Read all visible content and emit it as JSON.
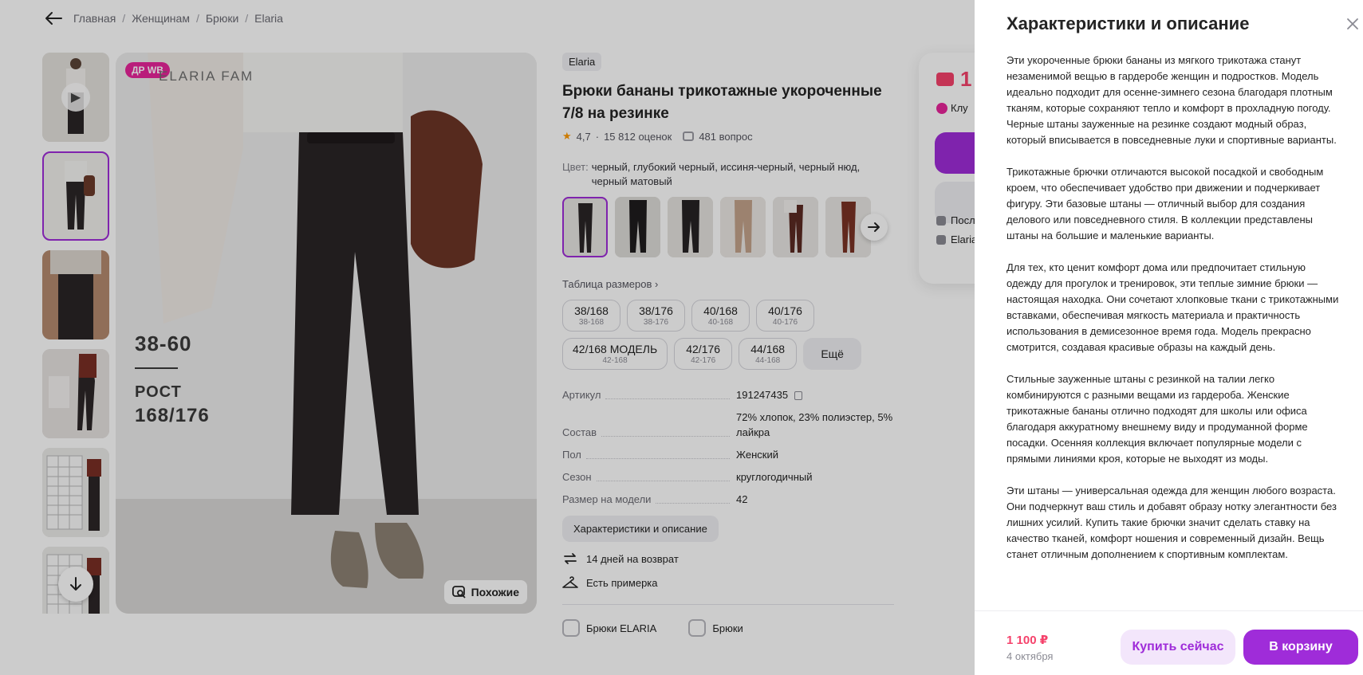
{
  "breadcrumbs": [
    "Главная",
    "Женщинам",
    "Брюки",
    "Elaria"
  ],
  "gallery": {
    "badge": "ДР WB",
    "watermark": "ELARIA FAM",
    "overlay_range": "38-60",
    "overlay_label": "РОСТ",
    "overlay_height": "168/176",
    "similar_label": "Похожие"
  },
  "product": {
    "brand": "Elaria",
    "title": "Брюки бананы трикотажные укороченные 7/8 на резинке",
    "rating": "4,7",
    "reviews": "15 812 оценок",
    "questions": "481 вопрос",
    "color_label": "Цвет:",
    "color_value": "черный, глубокий черный, иссиня-черный, черный нюд, черный матовый",
    "sizes_title": "Таблица размеров",
    "sizes": [
      {
        "main": "38/168",
        "sub": "38-168"
      },
      {
        "main": "38/176",
        "sub": "38-176"
      },
      {
        "main": "40/168",
        "sub": "40-168"
      },
      {
        "main": "40/176",
        "sub": "40-176"
      },
      {
        "main": "42/168 МОДЕЛЬ",
        "sub": "42-168"
      },
      {
        "main": "42/176",
        "sub": "42-176"
      },
      {
        "main": "44/168",
        "sub": "44-168"
      }
    ],
    "sizes_more": "Ещё",
    "specs": [
      {
        "k": "Артикул",
        "v": "191247435"
      },
      {
        "k": "Состав",
        "v": "72% хлопок, 23% полиэстер, 5% лайкра"
      },
      {
        "k": "Пол",
        "v": "Женский"
      },
      {
        "k": "Сезон",
        "v": "круглогодичный"
      },
      {
        "k": "Размер на модели",
        "v": "42"
      }
    ],
    "char_button": "Характеристики и описание",
    "perk_return": "14 дней на возврат",
    "perk_fitting": "Есть примерка",
    "cat1": "Брюки ELARIA",
    "cat2": "Брюки"
  },
  "buybox": {
    "price_partial": "1",
    "club_partial": "Клу",
    "row1": "Посл",
    "row2": "Elaria"
  },
  "panel": {
    "title": "Характеристики и описание",
    "paragraphs": [
      "Эти укороченные брюки бананы из мягкого трикотажа станут незаменимой вещью в гардеробе женщин и подростков. Модель идеально подходит для осенне-зимнего сезона благодаря плотным тканям, которые сохраняют тепло и комфорт в прохладную погоду. Черные штаны зауженные на резинке создают модный образ, который вписывается в повседневные луки и спортивные варианты.",
      "Трикотажные брючки отличаются высокой посадкой и свободным кроем, что обеспечивает удобство при движении и подчеркивает фигуру. Эти базовые штаны — отличный выбор для создания делового или повседневного стиля. В коллекции представлены штаны на большие и маленькие варианты.",
      "Для тех, кто ценит комфорт дома или предпочитает стильную одежду для прогулок и тренировок, эти теплые зимние брюки — настоящая находка. Они сочетают хлопковые ткани с трикотажными вставками, обеспечивая мягкость материала и практичность использования в демисезонное время года. Модель прекрасно смотрится, создавая красивые образы на каждый день.",
      "Стильные зауженные штаны с резинкой на талии легко комбинируются с разными вещами из гардероба. Женские трикотажные бананы отлично подходят для школы или офиса благодаря аккуратному внешнему виду и продуманной форме посадки. Осенняя коллекция включает популярные модели с прямыми линиями кроя, которые не выходят из моды.",
      "Эти штаны — универсальная одежда для женщин любого возраста. Они подчеркнут ваш стиль и добавят образу нотку элегантности без лишних усилий. Купить такие брючки значит сделать ставку на качество тканей, комфорт ношения и современный дизайн. Вещь станет отличным дополнением к спортивным комплектам."
    ],
    "price": "1 100 ₽",
    "delivery_date": "4 октября",
    "buy_now": "Купить сейчас",
    "to_cart": "В корзину"
  },
  "colors": {
    "accent": "#9f2cd9",
    "price": "#f5426b",
    "badge": "#e8259a"
  }
}
